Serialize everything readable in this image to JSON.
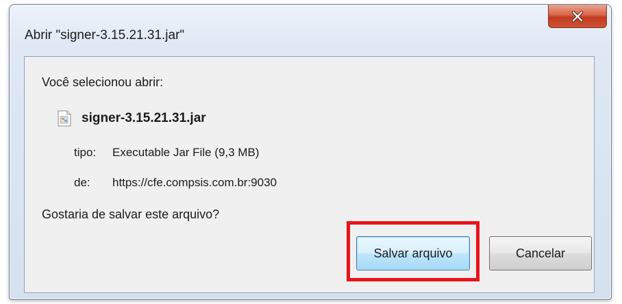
{
  "dialog": {
    "title": "Abrir \"signer-3.15.21.31.jar\"",
    "close_icon": "close-icon",
    "intro": "Você selecionou abrir:",
    "file": {
      "icon": "jar-file-icon",
      "name": "signer-3.15.21.31.jar",
      "type_label": "tipo:",
      "type_value": "Executable Jar File (9,3 MB)",
      "from_label": "de:",
      "from_value": "https://cfe.compsis.com.br:9030"
    },
    "question": "Gostaria de salvar este arquivo?",
    "buttons": {
      "save_label": "Salvar arquivo",
      "cancel_label": "Cancelar"
    },
    "annotation_color": "#e8141b"
  }
}
